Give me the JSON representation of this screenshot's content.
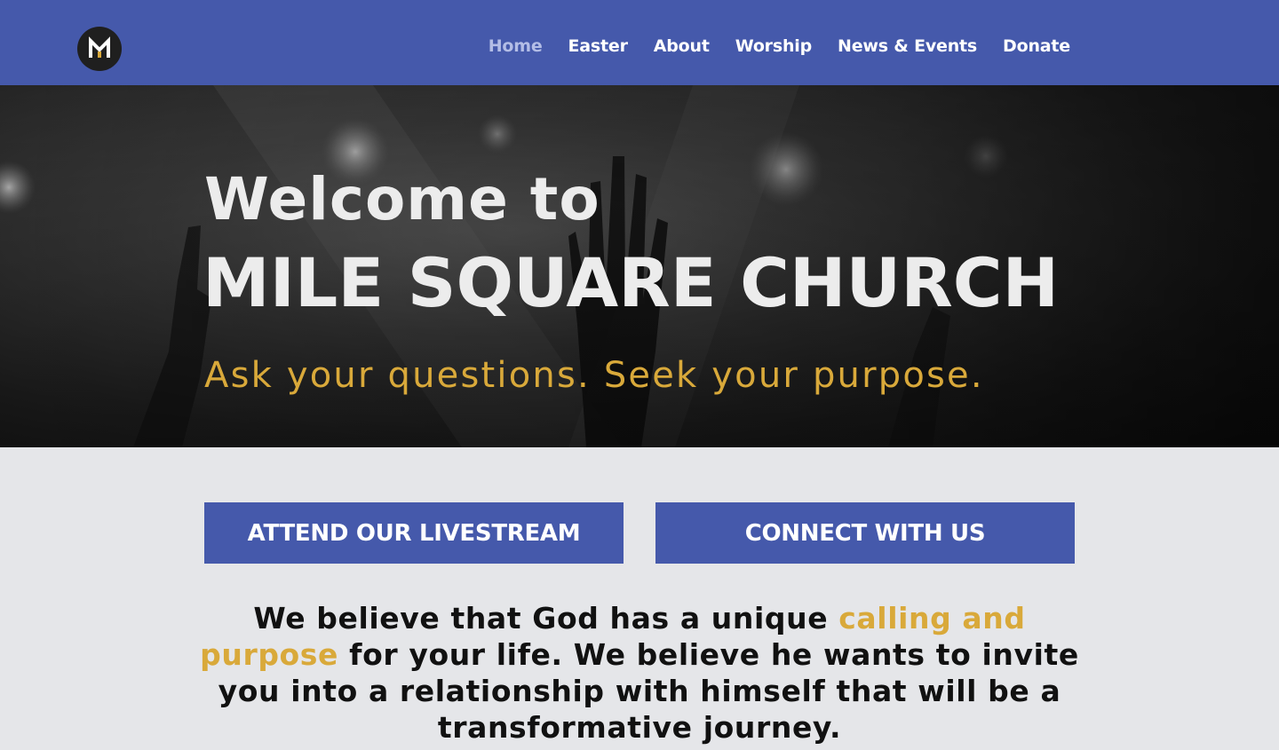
{
  "header": {
    "logo_letter": "M",
    "nav": [
      {
        "label": "Home",
        "active": true
      },
      {
        "label": "Easter",
        "active": false
      },
      {
        "label": "About",
        "active": false
      },
      {
        "label": "Worship",
        "active": false
      },
      {
        "label": "News & Events",
        "active": false
      },
      {
        "label": "Donate",
        "active": false
      }
    ]
  },
  "hero": {
    "welcome": "Welcome to",
    "title": "MILE SQUARE CHURCH",
    "tagline": "Ask your questions. Seek your purpose."
  },
  "cta": {
    "livestream_label": "ATTEND OUR LIVESTREAM",
    "connect_label": "CONNECT WITH US"
  },
  "statement": {
    "before": "We believe that God has a unique ",
    "highlight": "calling and purpose",
    "after": " for your life. We believe he wants to invite you into a relationship with himself that will be a transformative journey."
  },
  "colors": {
    "brand_blue": "#4559ab",
    "accent_gold": "#d9a93a",
    "nav_active": "#b3bde6",
    "page_bg": "#e5e6e9"
  }
}
